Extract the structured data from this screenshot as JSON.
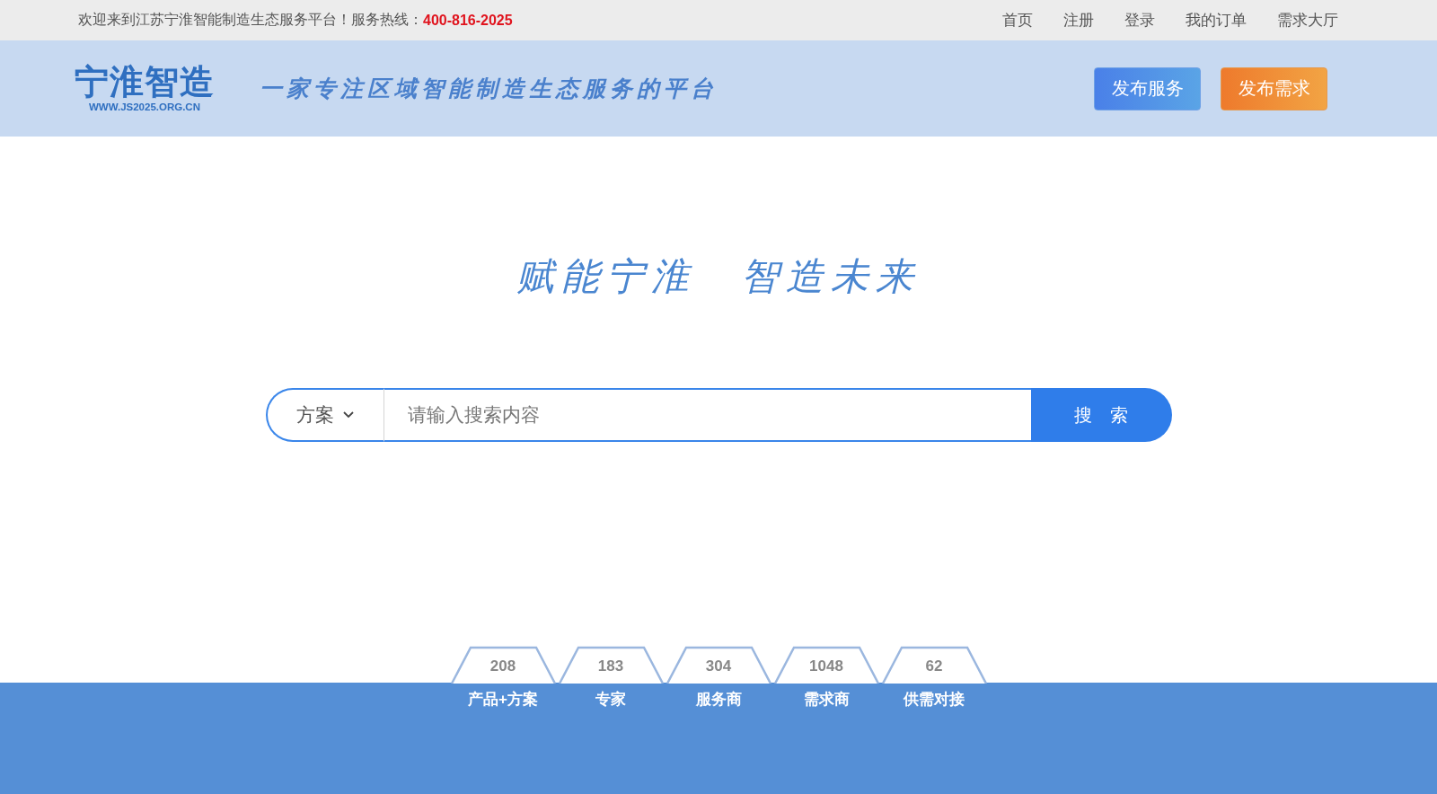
{
  "top_bar": {
    "welcome": "欢迎来到江苏宁淮智能制造生态服务平台！服务热线：",
    "hotline": "400-816-2025",
    "links": [
      "首页",
      "注册",
      "登录",
      "我的订单",
      "需求大厅"
    ]
  },
  "header": {
    "logo": {
      "name": "宁淮智造",
      "url": "WWW.JS2025.ORG.CN"
    },
    "tagline": "一家专注区域智能制造生态服务的平台",
    "buttons": [
      {
        "label": "发布服务",
        "kind": "blue"
      },
      {
        "label": "发布需求",
        "kind": "orange"
      }
    ]
  },
  "hero": {
    "slogan": "赋能宁淮　智造未来"
  },
  "search": {
    "category": "方案",
    "placeholder": "请输入搜索内容",
    "button": "搜　索"
  },
  "stats": [
    {
      "count": "208",
      "label": "产品+方案"
    },
    {
      "count": "183",
      "label": "专家"
    },
    {
      "count": "304",
      "label": "服务商"
    },
    {
      "count": "1048",
      "label": "需求商"
    },
    {
      "count": "62",
      "label": "供需对接"
    }
  ]
}
